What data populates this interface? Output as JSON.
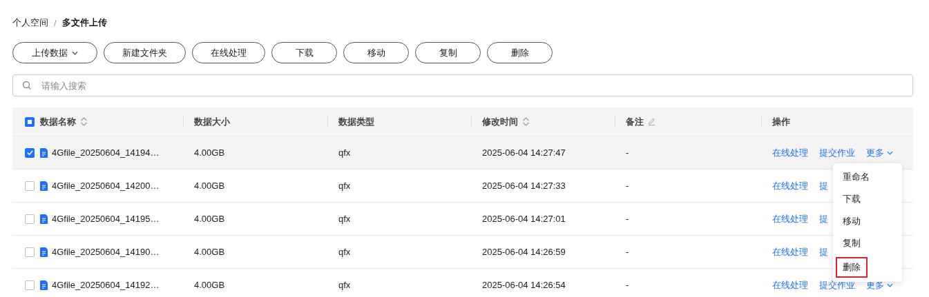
{
  "breadcrumb": [
    {
      "label": "个人空间",
      "current": false
    },
    {
      "label": "/",
      "kind": "separator"
    },
    {
      "label": "多文件上传",
      "current": true
    }
  ],
  "toolbar": [
    {
      "label": "上传数据",
      "dropdown": true
    },
    {
      "label": "新建文件夹"
    },
    {
      "label": "在线处理"
    },
    {
      "label": "下载"
    },
    {
      "label": "移动"
    },
    {
      "label": "复制"
    },
    {
      "label": "删除"
    }
  ],
  "search": {
    "placeholder": "请输入搜索"
  },
  "table": {
    "select_all": {
      "indeterminate": true
    },
    "columns": [
      {
        "label": "数据名称",
        "kind": "sortable"
      },
      {
        "label": "数据大小",
        "kind": "plain"
      },
      {
        "label": "数据类型",
        "kind": "plain"
      },
      {
        "label": "修改时间",
        "kind": "sortable"
      },
      {
        "label": "备注",
        "kind": "editable"
      },
      {
        "label": "操作",
        "kind": "plain"
      }
    ],
    "rows": [
      {
        "selected": true,
        "name": "4Gfile_20250604_14194…",
        "size": "4.00GB",
        "type": "qfx",
        "modified": "2025-06-04 14:27:47",
        "note": "-",
        "actions": [
          {
            "label": "在线处理",
            "kind": "link"
          },
          {
            "label": "提交作业",
            "kind": "link"
          },
          {
            "label": "更多",
            "kind": "more",
            "expanded": true
          }
        ]
      },
      {
        "selected": false,
        "name": "4Gfile_20250604_14200…",
        "size": "4.00GB",
        "type": "qfx",
        "modified": "2025-06-04 14:27:33",
        "note": "-",
        "actions": [
          {
            "label": "在线处理",
            "kind": "link"
          },
          {
            "label": "提",
            "kind": "link"
          }
        ]
      },
      {
        "selected": false,
        "name": "4Gfile_20250604_14195…",
        "size": "4.00GB",
        "type": "qfx",
        "modified": "2025-06-04 14:27:01",
        "note": "-",
        "actions": [
          {
            "label": "在线处理",
            "kind": "link"
          },
          {
            "label": "提",
            "kind": "link"
          }
        ]
      },
      {
        "selected": false,
        "name": "4Gfile_20250604_14190…",
        "size": "4.00GB",
        "type": "qfx",
        "modified": "2025-06-04 14:26:59",
        "note": "-",
        "actions": [
          {
            "label": "在线处理",
            "kind": "link"
          },
          {
            "label": "提",
            "kind": "link"
          }
        ]
      },
      {
        "selected": false,
        "name": "4Gfile_20250604_14192…",
        "size": "4.00GB",
        "type": "qfx",
        "modified": "2025-06-04 14:26:54",
        "note": "-",
        "actions": [
          {
            "label": "在线处理",
            "kind": "link"
          },
          {
            "label": "提交作业",
            "kind": "link"
          },
          {
            "label": "更多",
            "kind": "more",
            "expanded": false
          }
        ]
      }
    ]
  },
  "more_menu": {
    "items": [
      {
        "label": "重命名",
        "highlighted": false
      },
      {
        "label": "下载",
        "highlighted": false
      },
      {
        "label": "移动",
        "highlighted": false
      },
      {
        "label": "复制",
        "highlighted": false
      },
      {
        "label": "删除",
        "highlighted": true
      }
    ]
  }
}
